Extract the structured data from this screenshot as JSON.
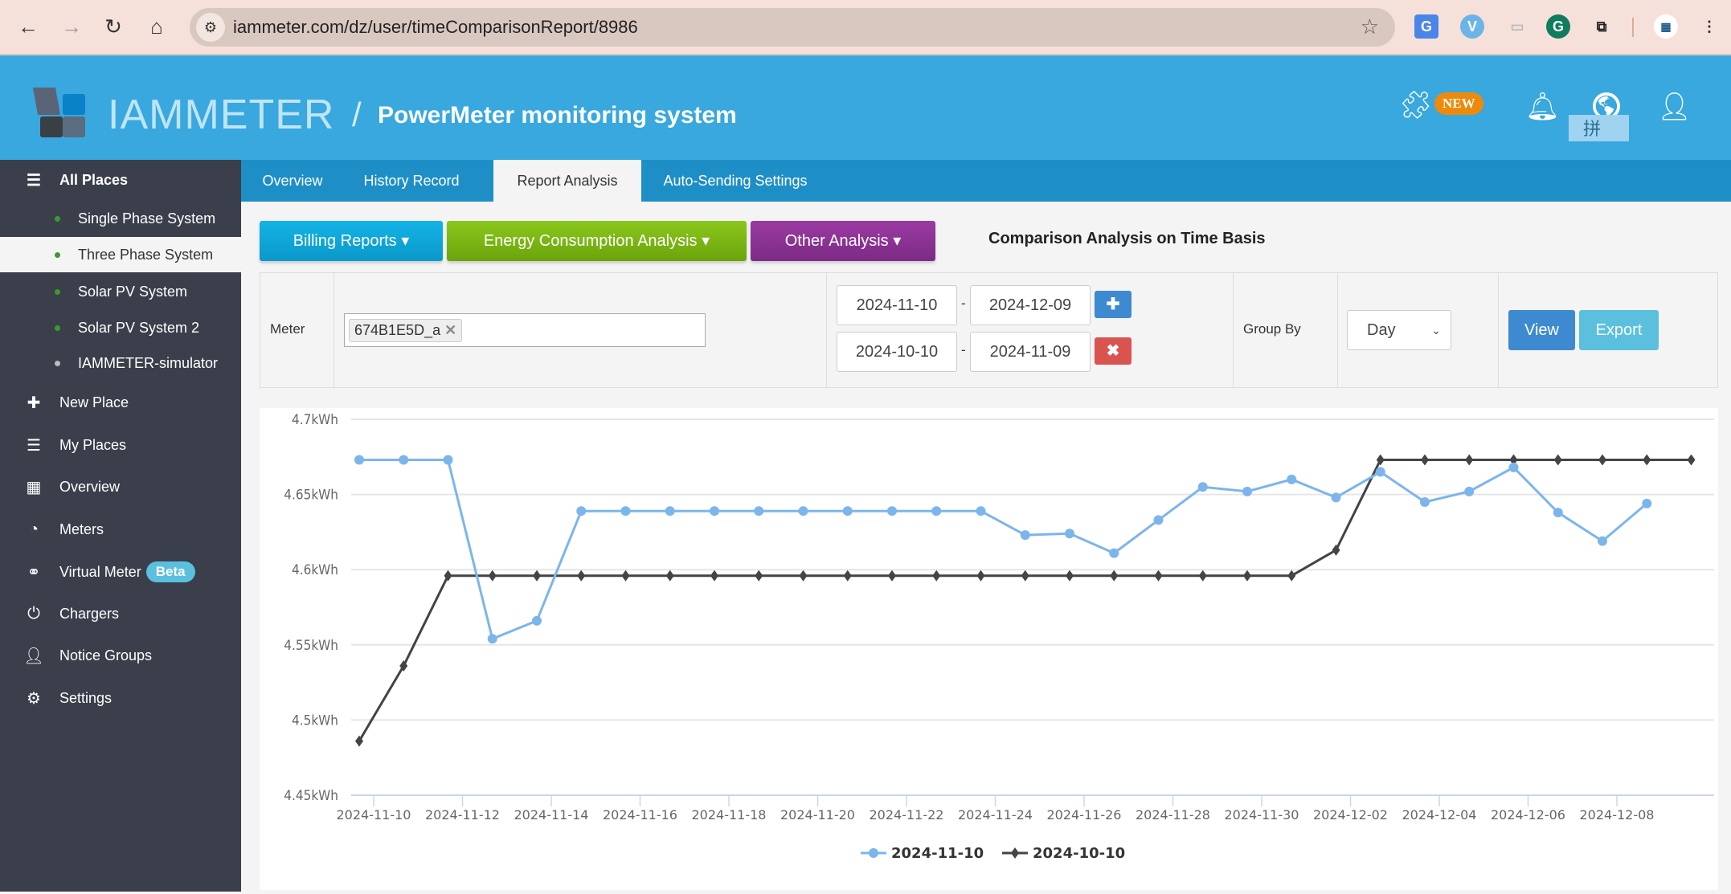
{
  "browser": {
    "url": "iammeter.com/dz/user/timeComparisonReport/8986",
    "nav_icons": [
      "back-arrow-icon",
      "forward-arrow-icon",
      "reload-icon",
      "home-icon"
    ],
    "extensions": [
      "google-translate-icon",
      "v-extension-icon",
      "screen-extension-icon",
      "grammarly-icon",
      "puzzle-extensions-icon",
      "profile-avatar-icon",
      "kebab-menu-icon"
    ]
  },
  "header": {
    "brand": "IAMMETER",
    "separator": "/",
    "title": "PowerMeter monitoring system",
    "new_badge": "NEW",
    "ime_char": "拼",
    "colors": {
      "bar": "#38a8de",
      "badge": "#ee8a0b"
    }
  },
  "sidebar": {
    "all_places": "All Places",
    "places": [
      {
        "label": "Single Phase System",
        "status": "online"
      },
      {
        "label": "Three Phase System",
        "status": "online",
        "active": true
      },
      {
        "label": "Solar PV System",
        "status": "online"
      },
      {
        "label": "Solar PV System 2",
        "status": "online"
      },
      {
        "label": "IAMMETER-simulator",
        "status": "offline"
      }
    ],
    "items": [
      {
        "label": "New Place",
        "icon": "plus-icon"
      },
      {
        "label": "My Places",
        "icon": "server-icon"
      },
      {
        "label": "Overview",
        "icon": "grid-icon"
      },
      {
        "label": "Meters",
        "icon": "dashboard-gauge-icon"
      },
      {
        "label": "Virtual Meter",
        "icon": "link-icon",
        "badge": "Beta"
      },
      {
        "label": "Chargers",
        "icon": "power-icon"
      },
      {
        "label": "Notice Groups",
        "icon": "user-icon"
      },
      {
        "label": "Settings",
        "icon": "gear-icon"
      }
    ]
  },
  "tabs": [
    "Overview",
    "History Record",
    "Report Analysis",
    "Auto-Sending Settings"
  ],
  "active_tab": "Report Analysis",
  "toolbar": {
    "billing": "Billing Reports",
    "energy": "Energy Consumption Analysis",
    "other": "Other Analysis",
    "title": "Comparison Analysis on Time Basis"
  },
  "form": {
    "meter_label": "Meter",
    "meter_tag": "674B1E5D_a",
    "range1_start": "2024-11-10",
    "range1_end": "2024-12-09",
    "range2_start": "2024-10-10",
    "range2_end": "2024-11-09",
    "dash": "-",
    "group_by_label": "Group By",
    "group_by_value": "Day",
    "view": "View",
    "export": "Export"
  },
  "chart_data": {
    "type": "line",
    "y_tick_labels": [
      "4.7kWh",
      "4.65kWh",
      "4.6kWh",
      "4.55kWh",
      "4.5kWh",
      "4.45kWh"
    ],
    "ylim": [
      4.45,
      4.7
    ],
    "y_unit": "kWh",
    "grid": true,
    "legend": "bottom",
    "x_tick_labels": [
      "2024-11-10",
      "2024-11-12",
      "2024-11-14",
      "2024-11-16",
      "2024-11-18",
      "2024-11-20",
      "2024-11-22",
      "2024-11-24",
      "2024-11-26",
      "2024-11-28",
      "2024-11-30",
      "2024-12-02",
      "2024-12-04",
      "2024-12-06",
      "2024-12-08"
    ],
    "series": [
      {
        "name": "2024-11-10",
        "color": "#7cb5ec",
        "marker": "circle",
        "values": [
          4.673,
          4.673,
          4.673,
          4.554,
          4.566,
          4.639,
          4.639,
          4.639,
          4.639,
          4.639,
          4.639,
          4.639,
          4.639,
          4.639,
          4.639,
          4.623,
          4.624,
          4.611,
          4.633,
          4.655,
          4.652,
          4.66,
          4.648,
          4.665,
          4.645,
          4.652,
          4.668,
          4.638,
          4.619,
          4.644
        ]
      },
      {
        "name": "2024-10-10",
        "color": "#434348",
        "marker": "diamond",
        "values": [
          4.486,
          4.536,
          4.596,
          4.596,
          4.596,
          4.596,
          4.596,
          4.596,
          4.596,
          4.596,
          4.596,
          4.596,
          4.596,
          4.596,
          4.596,
          4.596,
          4.596,
          4.596,
          4.596,
          4.596,
          4.596,
          4.596,
          4.613,
          4.673,
          4.673,
          4.673,
          4.673,
          4.673,
          4.673,
          4.673,
          4.673
        ]
      }
    ]
  }
}
